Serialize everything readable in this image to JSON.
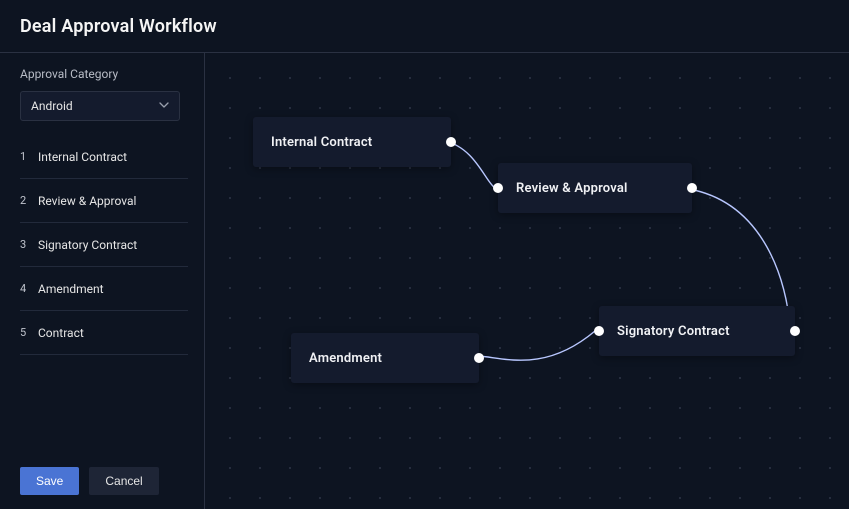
{
  "header": {
    "title": "Deal Approval Workflow"
  },
  "sidebar": {
    "category_label": "Approval Category",
    "category_value": "Android",
    "steps": [
      {
        "num": "1",
        "label": "Internal Contract"
      },
      {
        "num": "2",
        "label": "Review & Approval"
      },
      {
        "num": "3",
        "label": "Signatory Contract"
      },
      {
        "num": "4",
        "label": "Amendment"
      },
      {
        "num": "5",
        "label": "Contract"
      }
    ],
    "save_label": "Save",
    "cancel_label": "Cancel"
  },
  "nodes": {
    "internal_contract": "Internal Contract",
    "review_approval": "Review & Approval",
    "signatory_contract": "Signatory Contract",
    "amendment": "Amendment"
  }
}
